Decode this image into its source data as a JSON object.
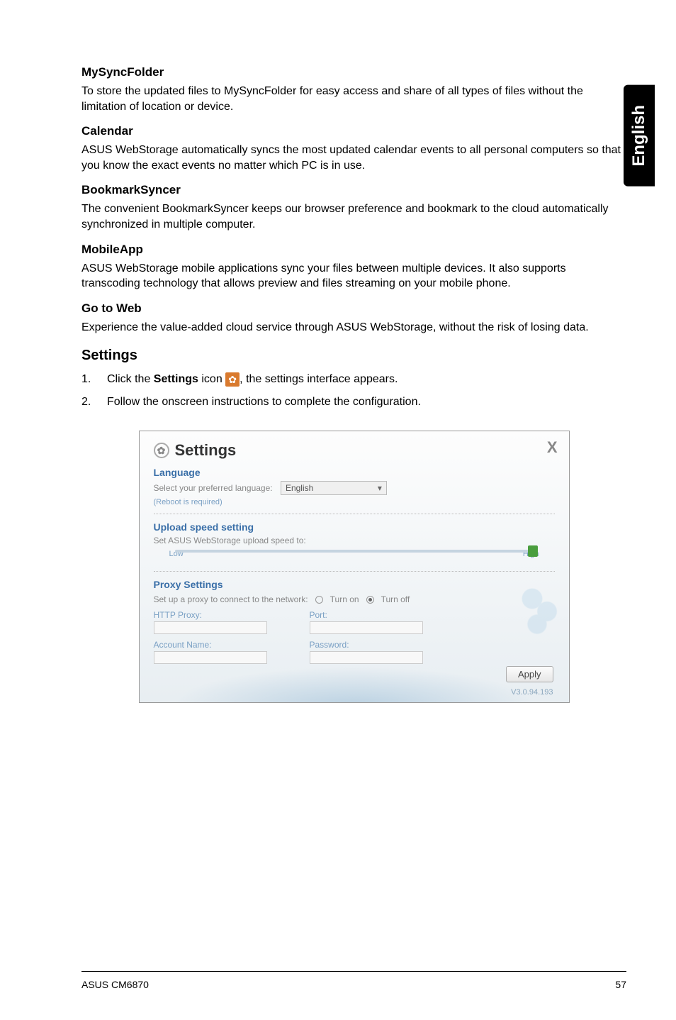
{
  "sideTab": "English",
  "sections": {
    "mysync": {
      "title": "MySyncFolder",
      "body": "To store the updated files to MySyncFolder for easy access and share of all types of files without the limitation of location or device."
    },
    "calendar": {
      "title": "Calendar",
      "body": "ASUS WebStorage automatically syncs the most updated calendar events to all personal computers so that you know the exact events no matter which PC is in use."
    },
    "bookmark": {
      "title": "BookmarkSyncer",
      "body": "The convenient BookmarkSyncer keeps our browser preference and bookmark to the cloud automatically synchronized in multiple computer."
    },
    "mobile": {
      "title": "MobileApp",
      "body": "ASUS WebStorage mobile applications sync your files between multiple devices. It also supports transcoding technology that allows preview and files streaming on your mobile phone."
    },
    "gotoweb": {
      "title": "Go to Web",
      "body": "Experience the value-added cloud service through ASUS WebStorage, without the risk of losing data."
    }
  },
  "settings": {
    "heading": "Settings",
    "step1_pre": "Click the ",
    "step1_bold": "Settings",
    "step1_post_icon_pre": " icon ",
    "step1_post": ", the settings interface appears.",
    "step2": "Follow the onscreen instructions to complete the configuration."
  },
  "screenshot": {
    "title": "Settings",
    "close": "X",
    "language": {
      "section": "Language",
      "label": "Select your preferred language:",
      "value": "English",
      "reboot": "(Reboot is required)"
    },
    "upload": {
      "section": "Upload speed setting",
      "label": "Set ASUS WebStorage upload speed to:",
      "low": "Low",
      "high": "High"
    },
    "proxy": {
      "section": "Proxy Settings",
      "label": "Set up a proxy to connect to the network:",
      "turnon": "Turn on",
      "turnoff": "Turn off",
      "http": "HTTP Proxy:",
      "port": "Port:",
      "account": "Account Name:",
      "password": "Password:"
    },
    "apply": "Apply",
    "version": "V3.0.94.193"
  },
  "footer": {
    "left": "ASUS CM6870",
    "right": "57"
  }
}
